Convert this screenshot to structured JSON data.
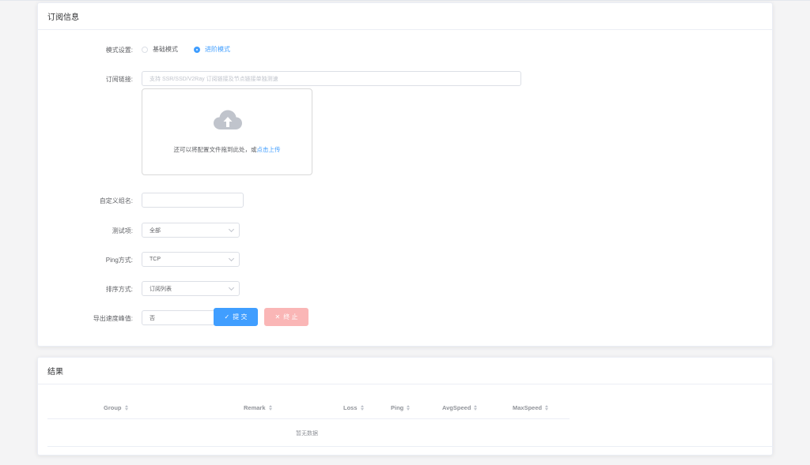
{
  "subscription": {
    "title": "订阅信息",
    "mode": {
      "label": "模式设置:",
      "options": [
        "基础模式",
        "进阶模式"
      ],
      "selected": "进阶模式"
    },
    "link": {
      "label": "订阅链接:",
      "placeholder": "支持 SSR/SSD/V2Ray 订阅链接及节点链接单独测速"
    },
    "upload": {
      "text": "还可以将配置文件拖到此处，或",
      "link_text": "点击上传"
    },
    "group": {
      "label": "自定义组名:",
      "value": ""
    },
    "test_item": {
      "label": "测试项:",
      "value": "全部"
    },
    "ping_method": {
      "label": "Ping方式:",
      "value": "TCP"
    },
    "sort_method": {
      "label": "排序方式:",
      "value": "订阅列表"
    },
    "export_peak": {
      "label": "导出速度峰值:",
      "value": "否"
    },
    "submit_label": "提 交",
    "stop_label": "终 止",
    "colors": {
      "primary": "#409eff",
      "danger_disabled": "#fab6b6"
    }
  },
  "results": {
    "title": "结果",
    "columns": [
      "Group",
      "Remark",
      "Loss",
      "Ping",
      "AvgSpeed",
      "MaxSpeed"
    ],
    "empty_text": "暂无数据"
  }
}
